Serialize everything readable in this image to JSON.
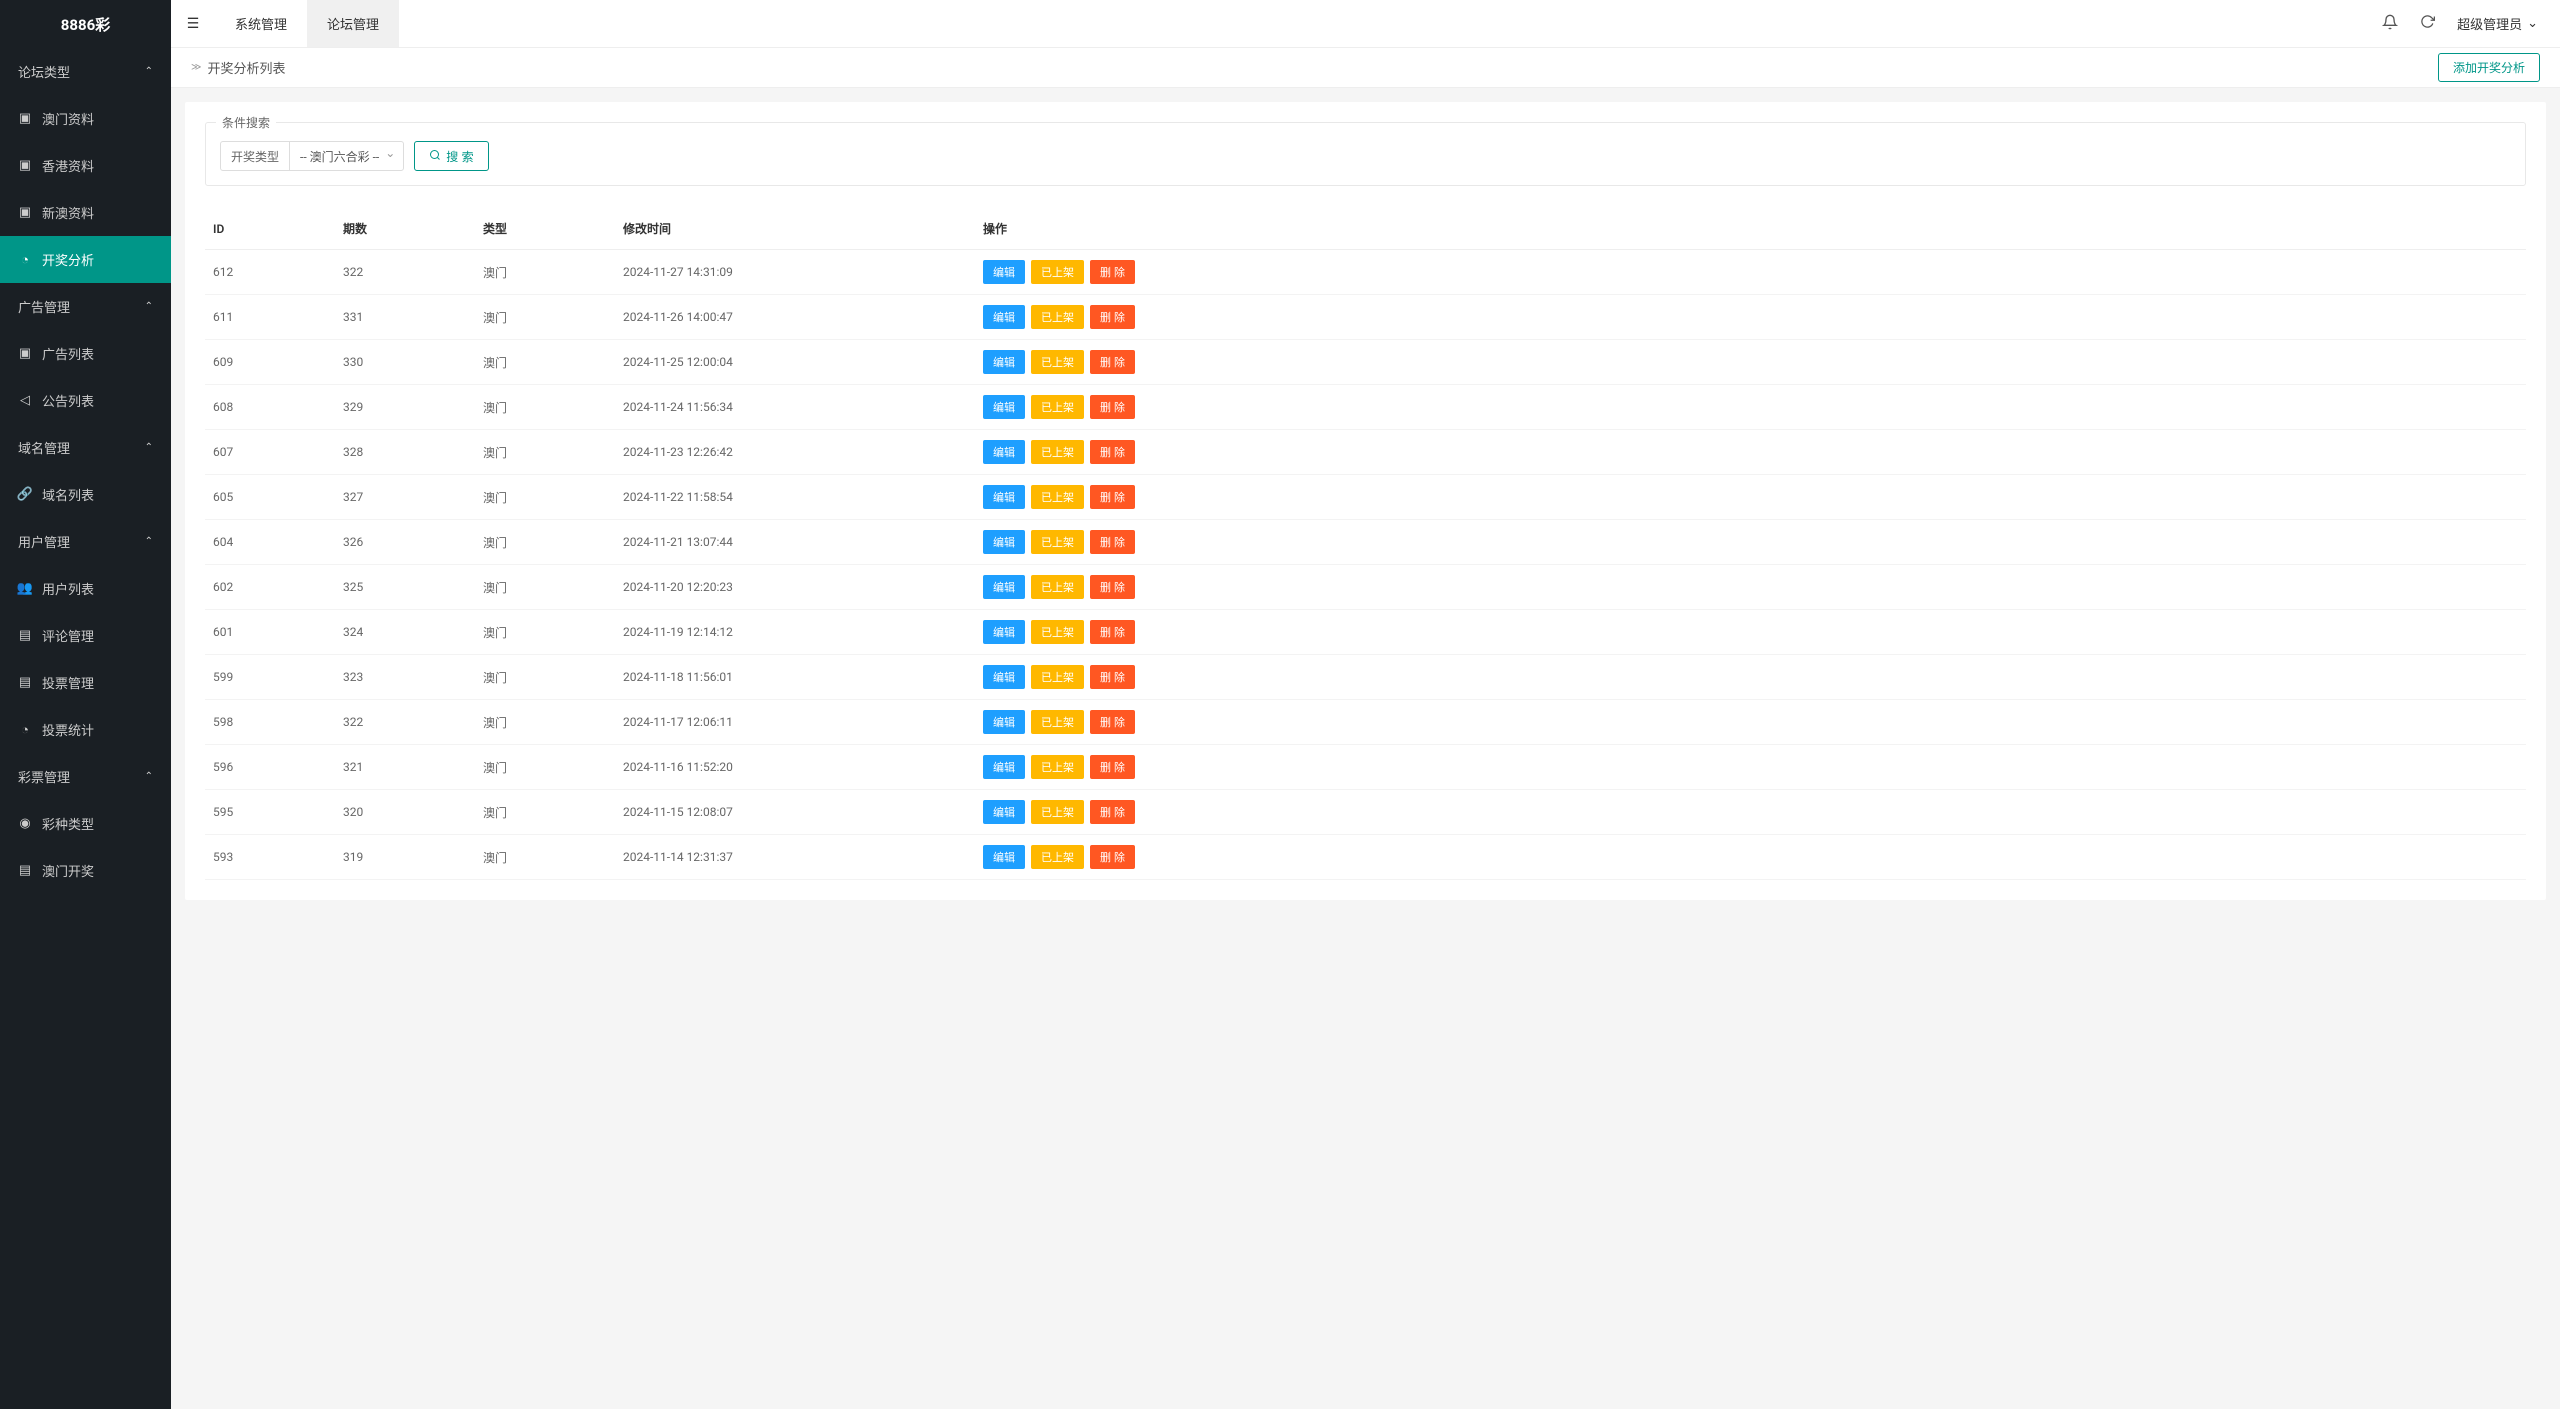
{
  "app": {
    "logo": "8886彩"
  },
  "sidebar": {
    "groups": [
      {
        "header": "论坛类型",
        "items": [
          {
            "icon": "▣",
            "label": "澳门资料",
            "name": "sidebar-macau-data"
          },
          {
            "icon": "▣",
            "label": "香港资料",
            "name": "sidebar-hk-data"
          },
          {
            "icon": "▣",
            "label": "新澳资料",
            "name": "sidebar-newau-data"
          },
          {
            "icon": "◔",
            "label": "开奖分析",
            "name": "sidebar-lottery-analysis",
            "active": true
          }
        ]
      },
      {
        "header": "广告管理",
        "items": [
          {
            "icon": "▣",
            "label": "广告列表",
            "name": "sidebar-ad-list"
          },
          {
            "icon": "◁",
            "label": "公告列表",
            "name": "sidebar-notice-list"
          }
        ]
      },
      {
        "header": "域名管理",
        "items": [
          {
            "icon": "🔗",
            "label": "域名列表",
            "name": "sidebar-domain-list"
          }
        ]
      },
      {
        "header": "用户管理",
        "items": [
          {
            "icon": "👥",
            "label": "用户列表",
            "name": "sidebar-user-list"
          },
          {
            "icon": "▤",
            "label": "评论管理",
            "name": "sidebar-comment-mgmt"
          },
          {
            "icon": "▤",
            "label": "投票管理",
            "name": "sidebar-vote-mgmt"
          },
          {
            "icon": "◔",
            "label": "投票统计",
            "name": "sidebar-vote-stats"
          }
        ]
      },
      {
        "header": "彩票管理",
        "items": [
          {
            "icon": "◉",
            "label": "彩种类型",
            "name": "sidebar-lottery-type"
          },
          {
            "icon": "▤",
            "label": "澳门开奖",
            "name": "sidebar-macau-lottery"
          }
        ]
      }
    ]
  },
  "topbar": {
    "tabs": [
      {
        "label": "系统管理",
        "name": "tab-system"
      },
      {
        "label": "论坛管理",
        "name": "tab-forum",
        "active": true
      }
    ],
    "user": "超级管理员"
  },
  "breadcrumb": {
    "page": "开奖分析列表",
    "action": "添加开奖分析"
  },
  "filter": {
    "legend": "条件搜索",
    "label": "开奖类型",
    "value": "-- 澳门六合彩 --",
    "searchLabel": "搜 索"
  },
  "table": {
    "headers": [
      "ID",
      "期数",
      "类型",
      "修改时间",
      "操作"
    ],
    "actionLabels": {
      "edit": "编辑",
      "status": "已上架",
      "delete": "删 除"
    },
    "rows": [
      {
        "id": "612",
        "period": "322",
        "type": "澳门",
        "time": "2024-11-27 14:31:09"
      },
      {
        "id": "611",
        "period": "331",
        "type": "澳门",
        "time": "2024-11-26 14:00:47"
      },
      {
        "id": "609",
        "period": "330",
        "type": "澳门",
        "time": "2024-11-25 12:00:04"
      },
      {
        "id": "608",
        "period": "329",
        "type": "澳门",
        "time": "2024-11-24 11:56:34"
      },
      {
        "id": "607",
        "period": "328",
        "type": "澳门",
        "time": "2024-11-23 12:26:42"
      },
      {
        "id": "605",
        "period": "327",
        "type": "澳门",
        "time": "2024-11-22 11:58:54"
      },
      {
        "id": "604",
        "period": "326",
        "type": "澳门",
        "time": "2024-11-21 13:07:44"
      },
      {
        "id": "602",
        "period": "325",
        "type": "澳门",
        "time": "2024-11-20 12:20:23"
      },
      {
        "id": "601",
        "period": "324",
        "type": "澳门",
        "time": "2024-11-19 12:14:12"
      },
      {
        "id": "599",
        "period": "323",
        "type": "澳门",
        "time": "2024-11-18 11:56:01"
      },
      {
        "id": "598",
        "period": "322",
        "type": "澳门",
        "time": "2024-11-17 12:06:11"
      },
      {
        "id": "596",
        "period": "321",
        "type": "澳门",
        "time": "2024-11-16 11:52:20"
      },
      {
        "id": "595",
        "period": "320",
        "type": "澳门",
        "time": "2024-11-15 12:08:07"
      },
      {
        "id": "593",
        "period": "319",
        "type": "澳门",
        "time": "2024-11-14 12:31:37"
      }
    ]
  }
}
